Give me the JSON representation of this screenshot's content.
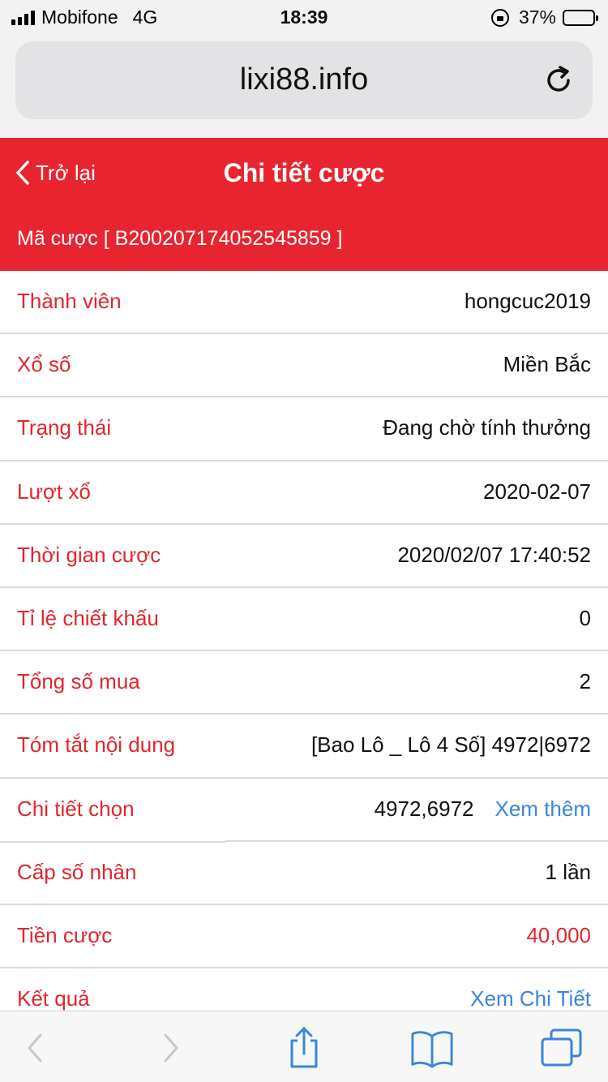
{
  "status_bar": {
    "carrier": "Mobifone",
    "network": "4G",
    "time": "18:39",
    "battery_percent": "37%",
    "battery_level": 0.37
  },
  "browser": {
    "url": "lixi88.info"
  },
  "header": {
    "back_label": "Trở lại",
    "title": "Chi tiết cược",
    "bet_code": "Mã cược [ B200207174052545859 ]"
  },
  "rows": [
    {
      "label": "Thành viên",
      "value": "hongcuc2019"
    },
    {
      "label": "Xổ số",
      "value": "Miền Bắc"
    },
    {
      "label": "Trạng thái",
      "value": "Đang chờ tính thưởng"
    },
    {
      "label": "Lượt xổ",
      "value": "2020-02-07"
    },
    {
      "label": "Thời gian cược",
      "value": "2020/02/07 17:40:52"
    },
    {
      "label": "Tỉ lệ chiết khấu",
      "value": "0"
    },
    {
      "label": "Tổng số mua",
      "value": "2"
    },
    {
      "label": "Tóm tắt nội dung",
      "value": "[Bao Lô _ Lô 4 Số] 4972|6972"
    },
    {
      "label": "Chi tiết chọn",
      "value": "4972,6972",
      "link": "Xem thêm"
    },
    {
      "label": "Cấp số nhân",
      "value": "1 lần"
    },
    {
      "label": "Tiền cược",
      "value": "40,000"
    },
    {
      "label": "Kết quả",
      "value": "Xem Chi Tiết"
    }
  ],
  "colors": {
    "header_red": "#e8252f",
    "label_red": "#e0262f",
    "link_blue": "#3a86d8",
    "toolbar_blue": "#3a86d8",
    "toolbar_disabled": "#c7c7cc"
  },
  "toolbar": {
    "icons": [
      "back-arrow-icon",
      "forward-arrow-icon",
      "share-icon",
      "bookmarks-icon",
      "tabs-icon"
    ]
  }
}
